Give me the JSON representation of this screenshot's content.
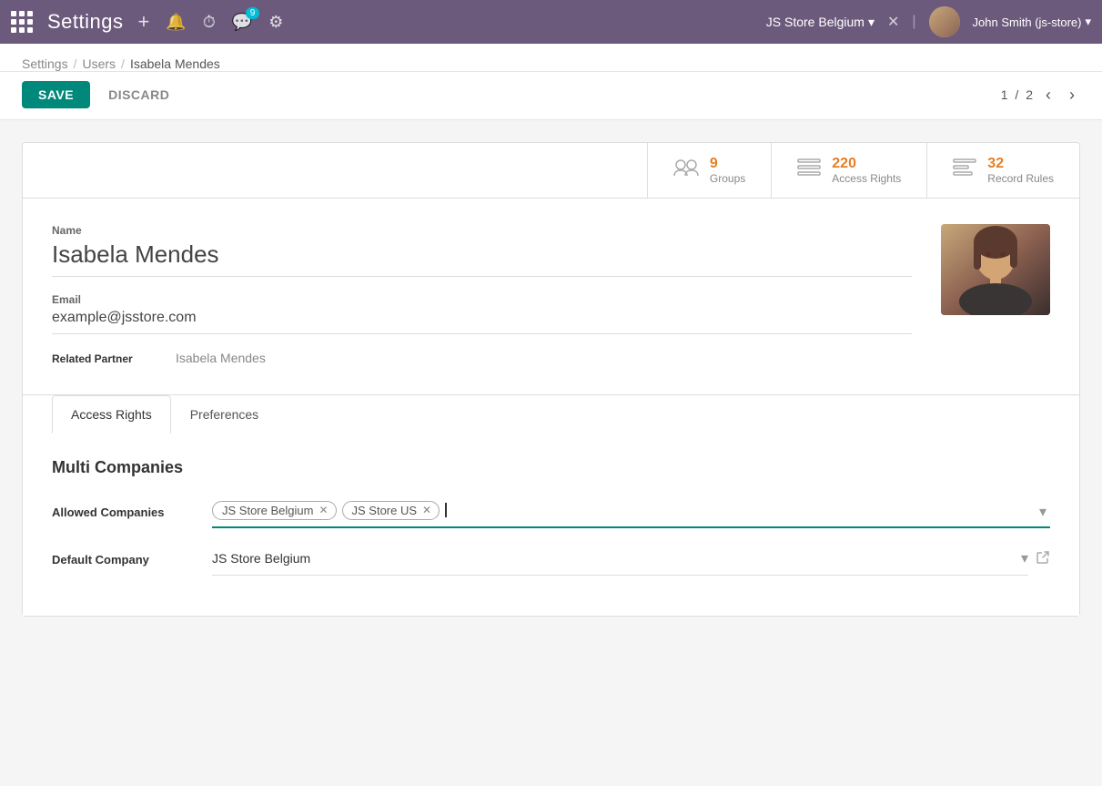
{
  "topnav": {
    "app_title": "Settings",
    "store_name": "JS Store Belgium",
    "store_dropdown": "▾",
    "x_label": "✕",
    "user_name": "John Smith (js-store)",
    "user_dropdown": "▾",
    "chat_badge": "9",
    "nav_icons": {
      "plus": "+",
      "bell": "🔔",
      "clock": "⏱",
      "chat": "💬",
      "grid": "⚙"
    }
  },
  "breadcrumb": {
    "parts": [
      "Settings",
      "Users",
      "Isabela Mendes"
    ],
    "separators": [
      "/",
      "/"
    ]
  },
  "toolbar": {
    "save_label": "SAVE",
    "discard_label": "DISCARD",
    "pager_current": "1",
    "pager_total": "2",
    "pager_sep": "/"
  },
  "stats": {
    "groups": {
      "count": "9",
      "label": "Groups"
    },
    "access_rights": {
      "count": "220",
      "label": "Access Rights"
    },
    "record_rules": {
      "count": "32",
      "label": "Record Rules"
    }
  },
  "form": {
    "name_label": "Name",
    "name_value": "Isabela Mendes",
    "email_label": "Email",
    "email_value": "example@jsstore.com",
    "related_partner_label": "Related Partner",
    "related_partner_value": "Isabela Mendes"
  },
  "tabs": {
    "tab1_label": "Access Rights",
    "tab2_label": "Preferences"
  },
  "access_rights": {
    "section_title": "Multi Companies",
    "allowed_companies_label": "Allowed Companies",
    "allowed_companies_tags": [
      {
        "label": "JS Store Belgium"
      },
      {
        "label": "JS Store US"
      }
    ],
    "default_company_label": "Default Company",
    "default_company_value": "JS Store Belgium"
  }
}
